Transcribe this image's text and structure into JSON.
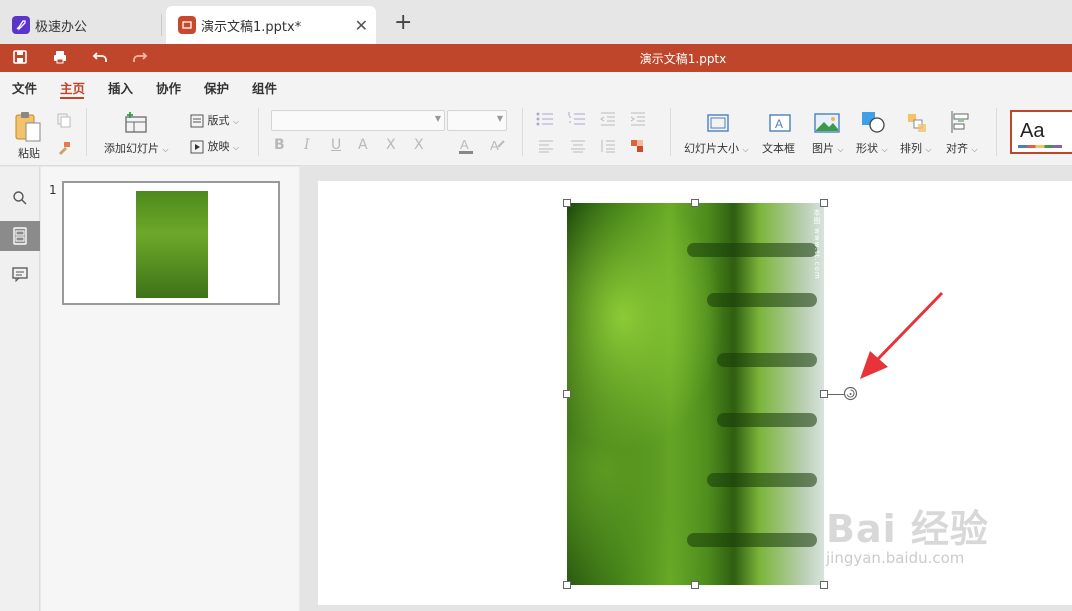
{
  "tabs": [
    {
      "label": "极速办公",
      "icon": "rocket-icon",
      "active": false
    },
    {
      "label": "演示文稿1.pptx*",
      "icon": "presentation-icon",
      "active": true
    }
  ],
  "title_bar": {
    "title": "演示文稿1.pptx",
    "bg_color": "#c0462b"
  },
  "menu": {
    "items": [
      "文件",
      "主页",
      "插入",
      "协作",
      "保护",
      "组件"
    ],
    "active": "主页"
  },
  "ribbon": {
    "paste": "粘贴",
    "add_slide": "添加幻灯片",
    "layout": "版式",
    "play": "放映",
    "slide_size": "幻灯片大小",
    "textbox": "文本框",
    "picture": "图片",
    "shape": "形状",
    "arrange": "排列",
    "align": "对齐",
    "theme_sample": "Aa",
    "bold": "B",
    "italic": "I",
    "underline": "U",
    "strike": "A",
    "superscript": "X",
    "subscript": "X"
  },
  "slides": {
    "thumbnail_number": "1"
  },
  "watermark": {
    "main": "Bai 经验",
    "sub": "jingyan.baidu.com",
    "photo_vertical_text": "本图 www.tt.com"
  }
}
